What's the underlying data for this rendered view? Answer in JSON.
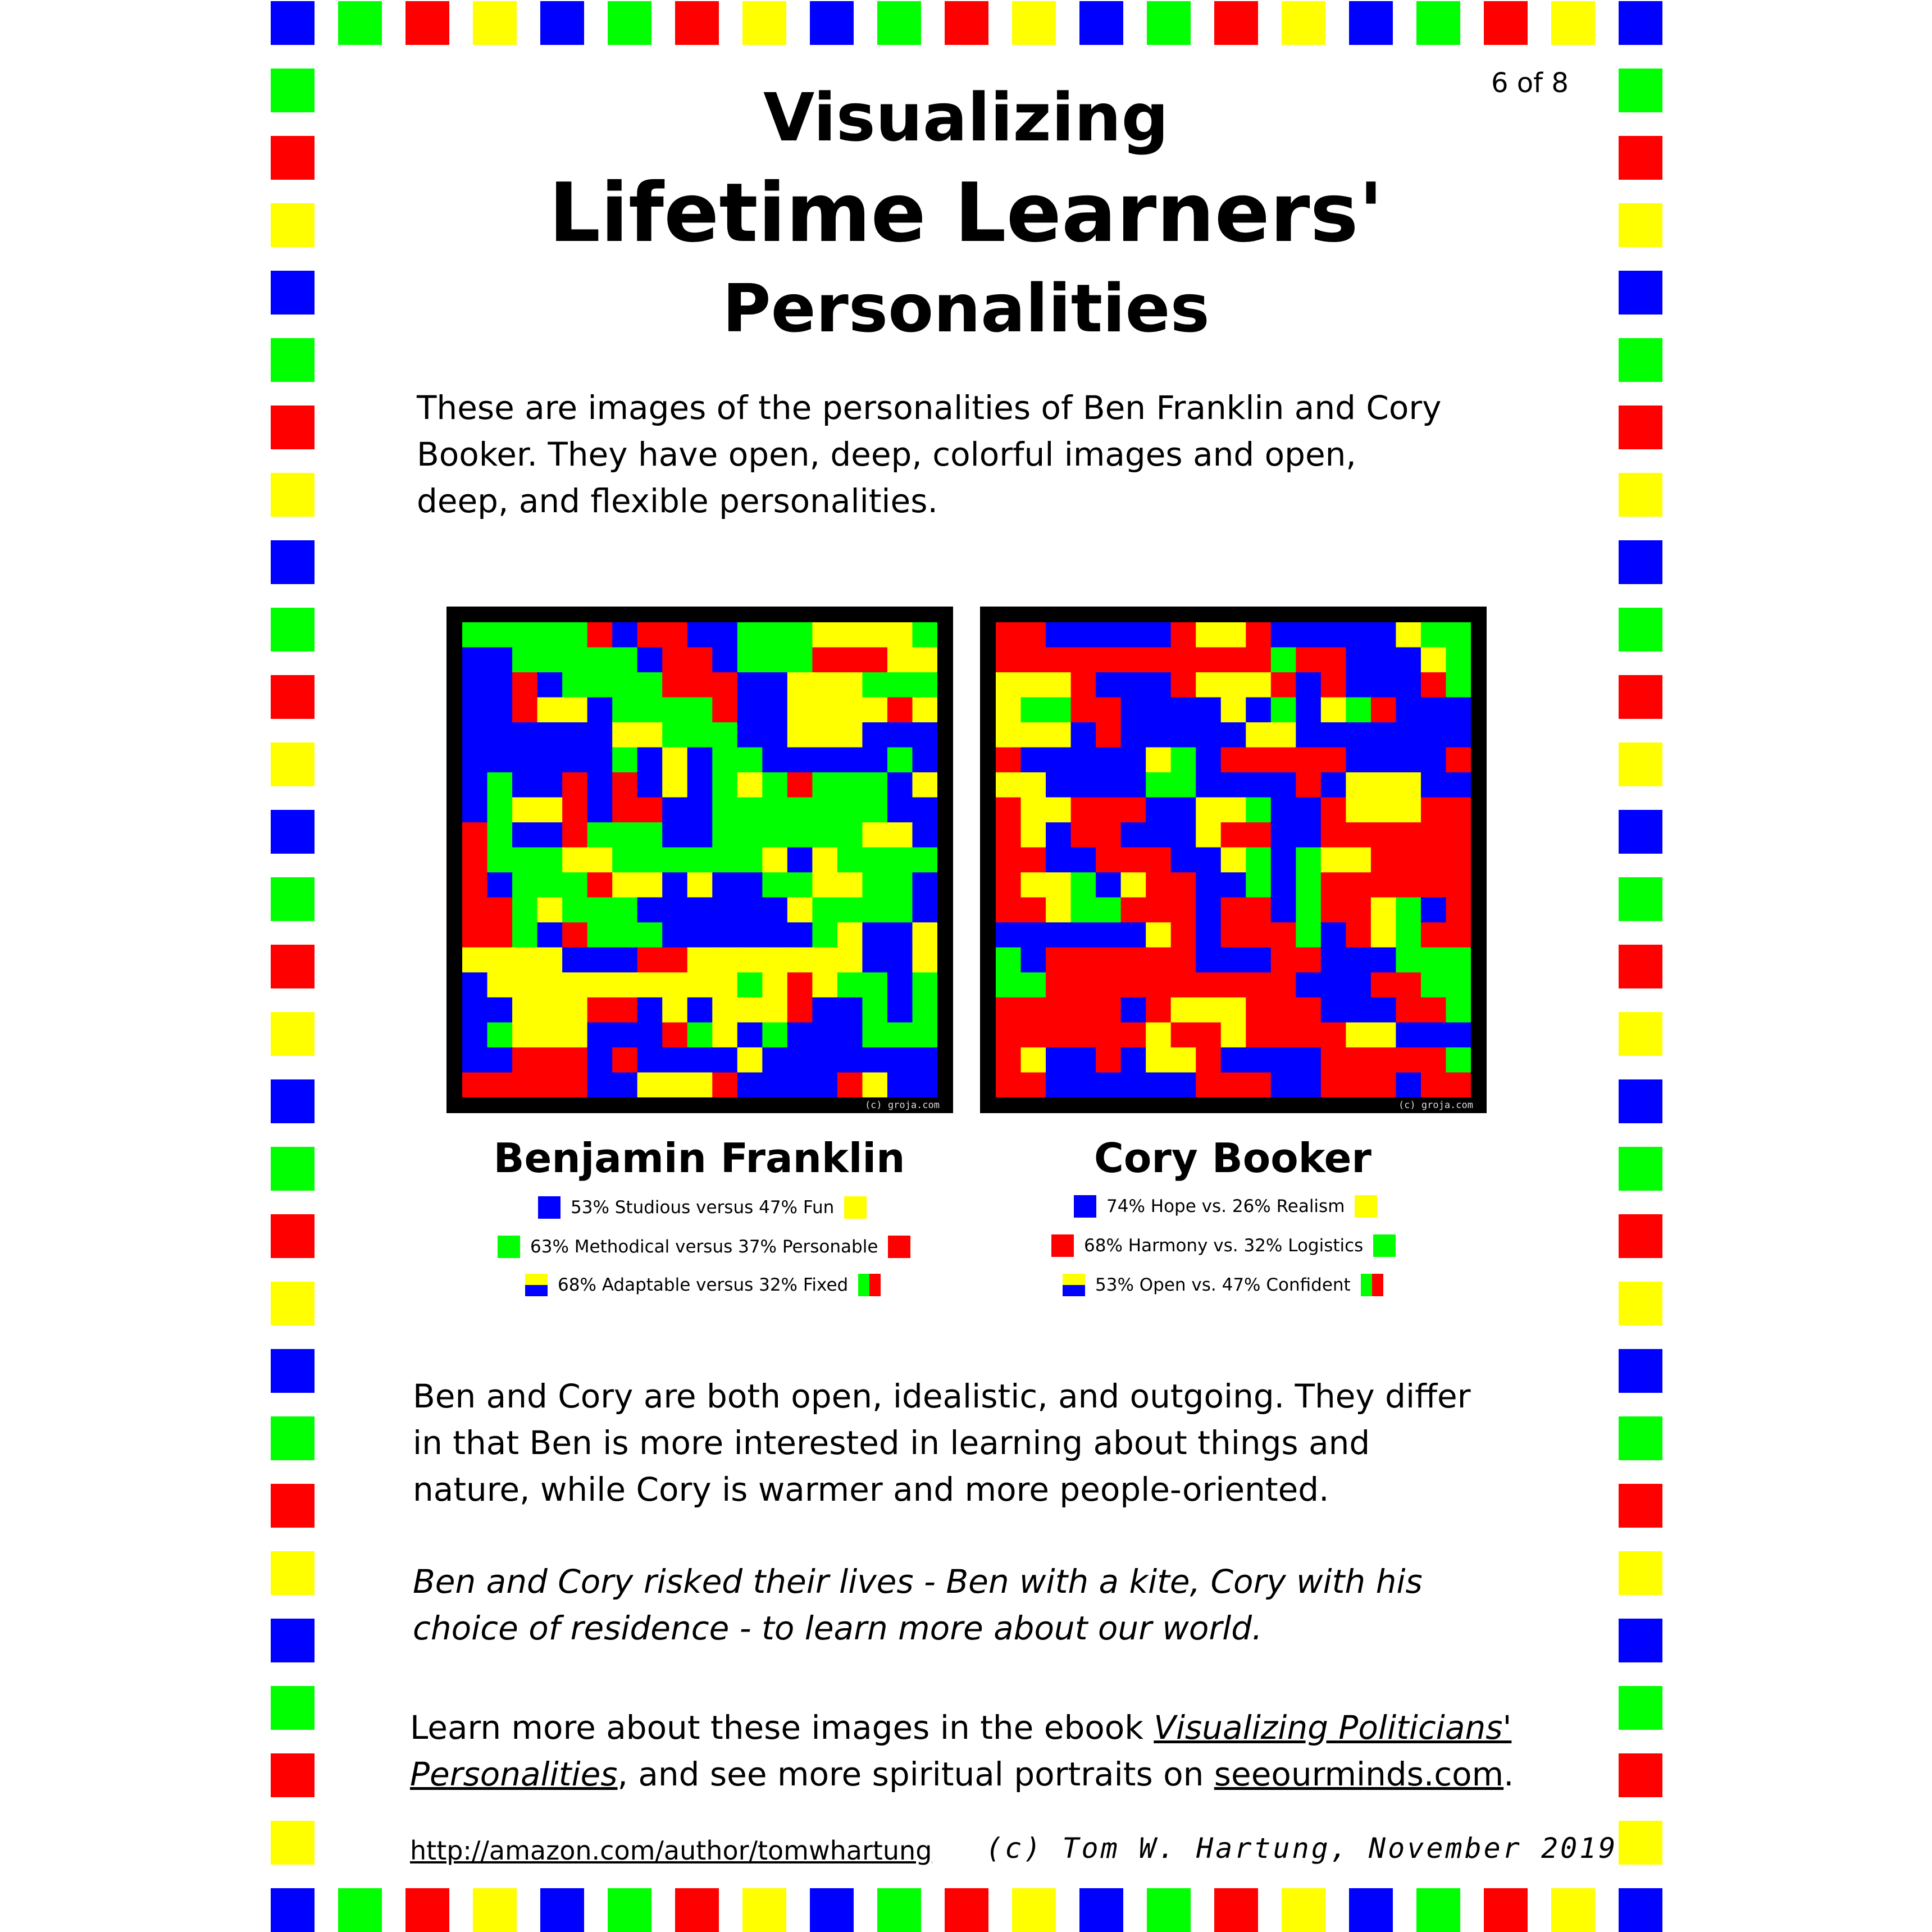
{
  "page_number": "6 of 8",
  "title": {
    "line1": "Visualizing",
    "line2": "Lifetime Learners'",
    "line3": "Personalities"
  },
  "intro_lines": [
    "These are images of the personalities of Ben Franklin and Cory",
    "Booker.  They have open, deep, colorful images and open,",
    "deep, and flexible personalities."
  ],
  "colors": {
    "blue": "#0000ff",
    "green": "#00ff00",
    "red": "#ff0000",
    "yellow": "#ffff00",
    "frame": "#000000"
  },
  "mosaic_credit": "(c) groja.com",
  "portraits": [
    {
      "name": "Benjamin Franklin",
      "legend": [
        {
          "text": "53% Studious versus 47% Fun",
          "left": "blue",
          "right": "yellow"
        },
        {
          "text": "63% Methodical versus 37% Personable",
          "left": "green",
          "right": "red"
        },
        {
          "text": "68% Adaptable versus 32% Fixed",
          "left": "yellow-blue",
          "right": "green-red"
        }
      ]
    },
    {
      "name": "Cory Booker",
      "legend": [
        {
          "text": "74% Hope vs. 26% Realism",
          "left": "blue",
          "right": "yellow"
        },
        {
          "text": "68% Harmony vs. 32% Logistics",
          "left": "red",
          "right": "green"
        },
        {
          "text": "53% Open vs. 47% Confident",
          "left": "yellow-blue",
          "right": "green-red"
        }
      ]
    }
  ],
  "body1_lines": [
    "Ben and Cory are both open, idealistic, and outgoing.  They differ",
    "in that Ben is more interested in learning about things and",
    "nature, while Cory is warmer and more people-oriented."
  ],
  "body2_lines": [
    "Ben and Cory risked their lives - Ben with a kite, Cory with his",
    "choice of residence - to learn more about our world."
  ],
  "learn_more": {
    "prefix": "Learn more about these images in the ebook ",
    "book_title_part1": "Visualizing Politicians'",
    "book_title_part2": "Personalities",
    "middle": ", and see more spiritual portraits on ",
    "site": "seeourminds.com",
    "suffix": "."
  },
  "footer": {
    "url": "http://amazon.com/author/tomwhartung",
    "copyright": "(c) Tom W. Hartung, November 2019"
  }
}
